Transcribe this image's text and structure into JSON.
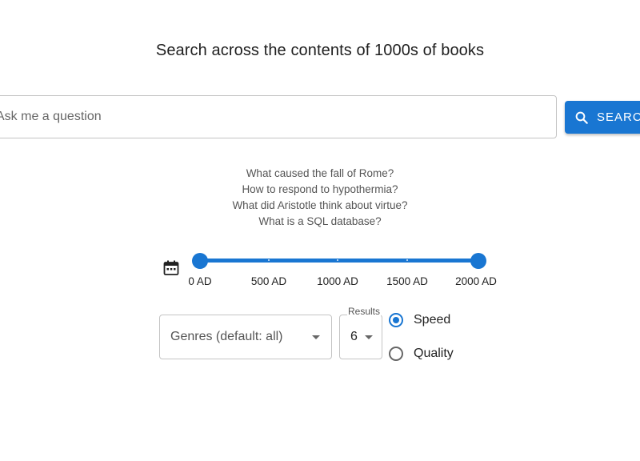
{
  "header": {
    "headline": "Search across the contents of 1000s of books"
  },
  "search": {
    "placeholder": "Ask me a question",
    "value": "",
    "button_label": "SEARCH"
  },
  "examples": [
    "What caused the fall of Rome?",
    "How to respond to hypothermia?",
    "What did Aristotle think about virtue?",
    "What is a SQL database?"
  ],
  "date_range": {
    "marks": [
      "0 AD",
      "500 AD",
      "1000 AD",
      "1500 AD",
      "2000 AD"
    ],
    "min": 0,
    "max": 2000,
    "selected_start": 0,
    "selected_end": 2000,
    "icon": "calendar-icon"
  },
  "filters": {
    "genres_value": "Genres (default: all)",
    "results_label": "Results",
    "results_value": "6"
  },
  "mode": {
    "options": [
      "Speed",
      "Quality"
    ],
    "selected": "Speed"
  },
  "colors": {
    "primary": "#1976d2",
    "border": "#c4c4c4"
  }
}
